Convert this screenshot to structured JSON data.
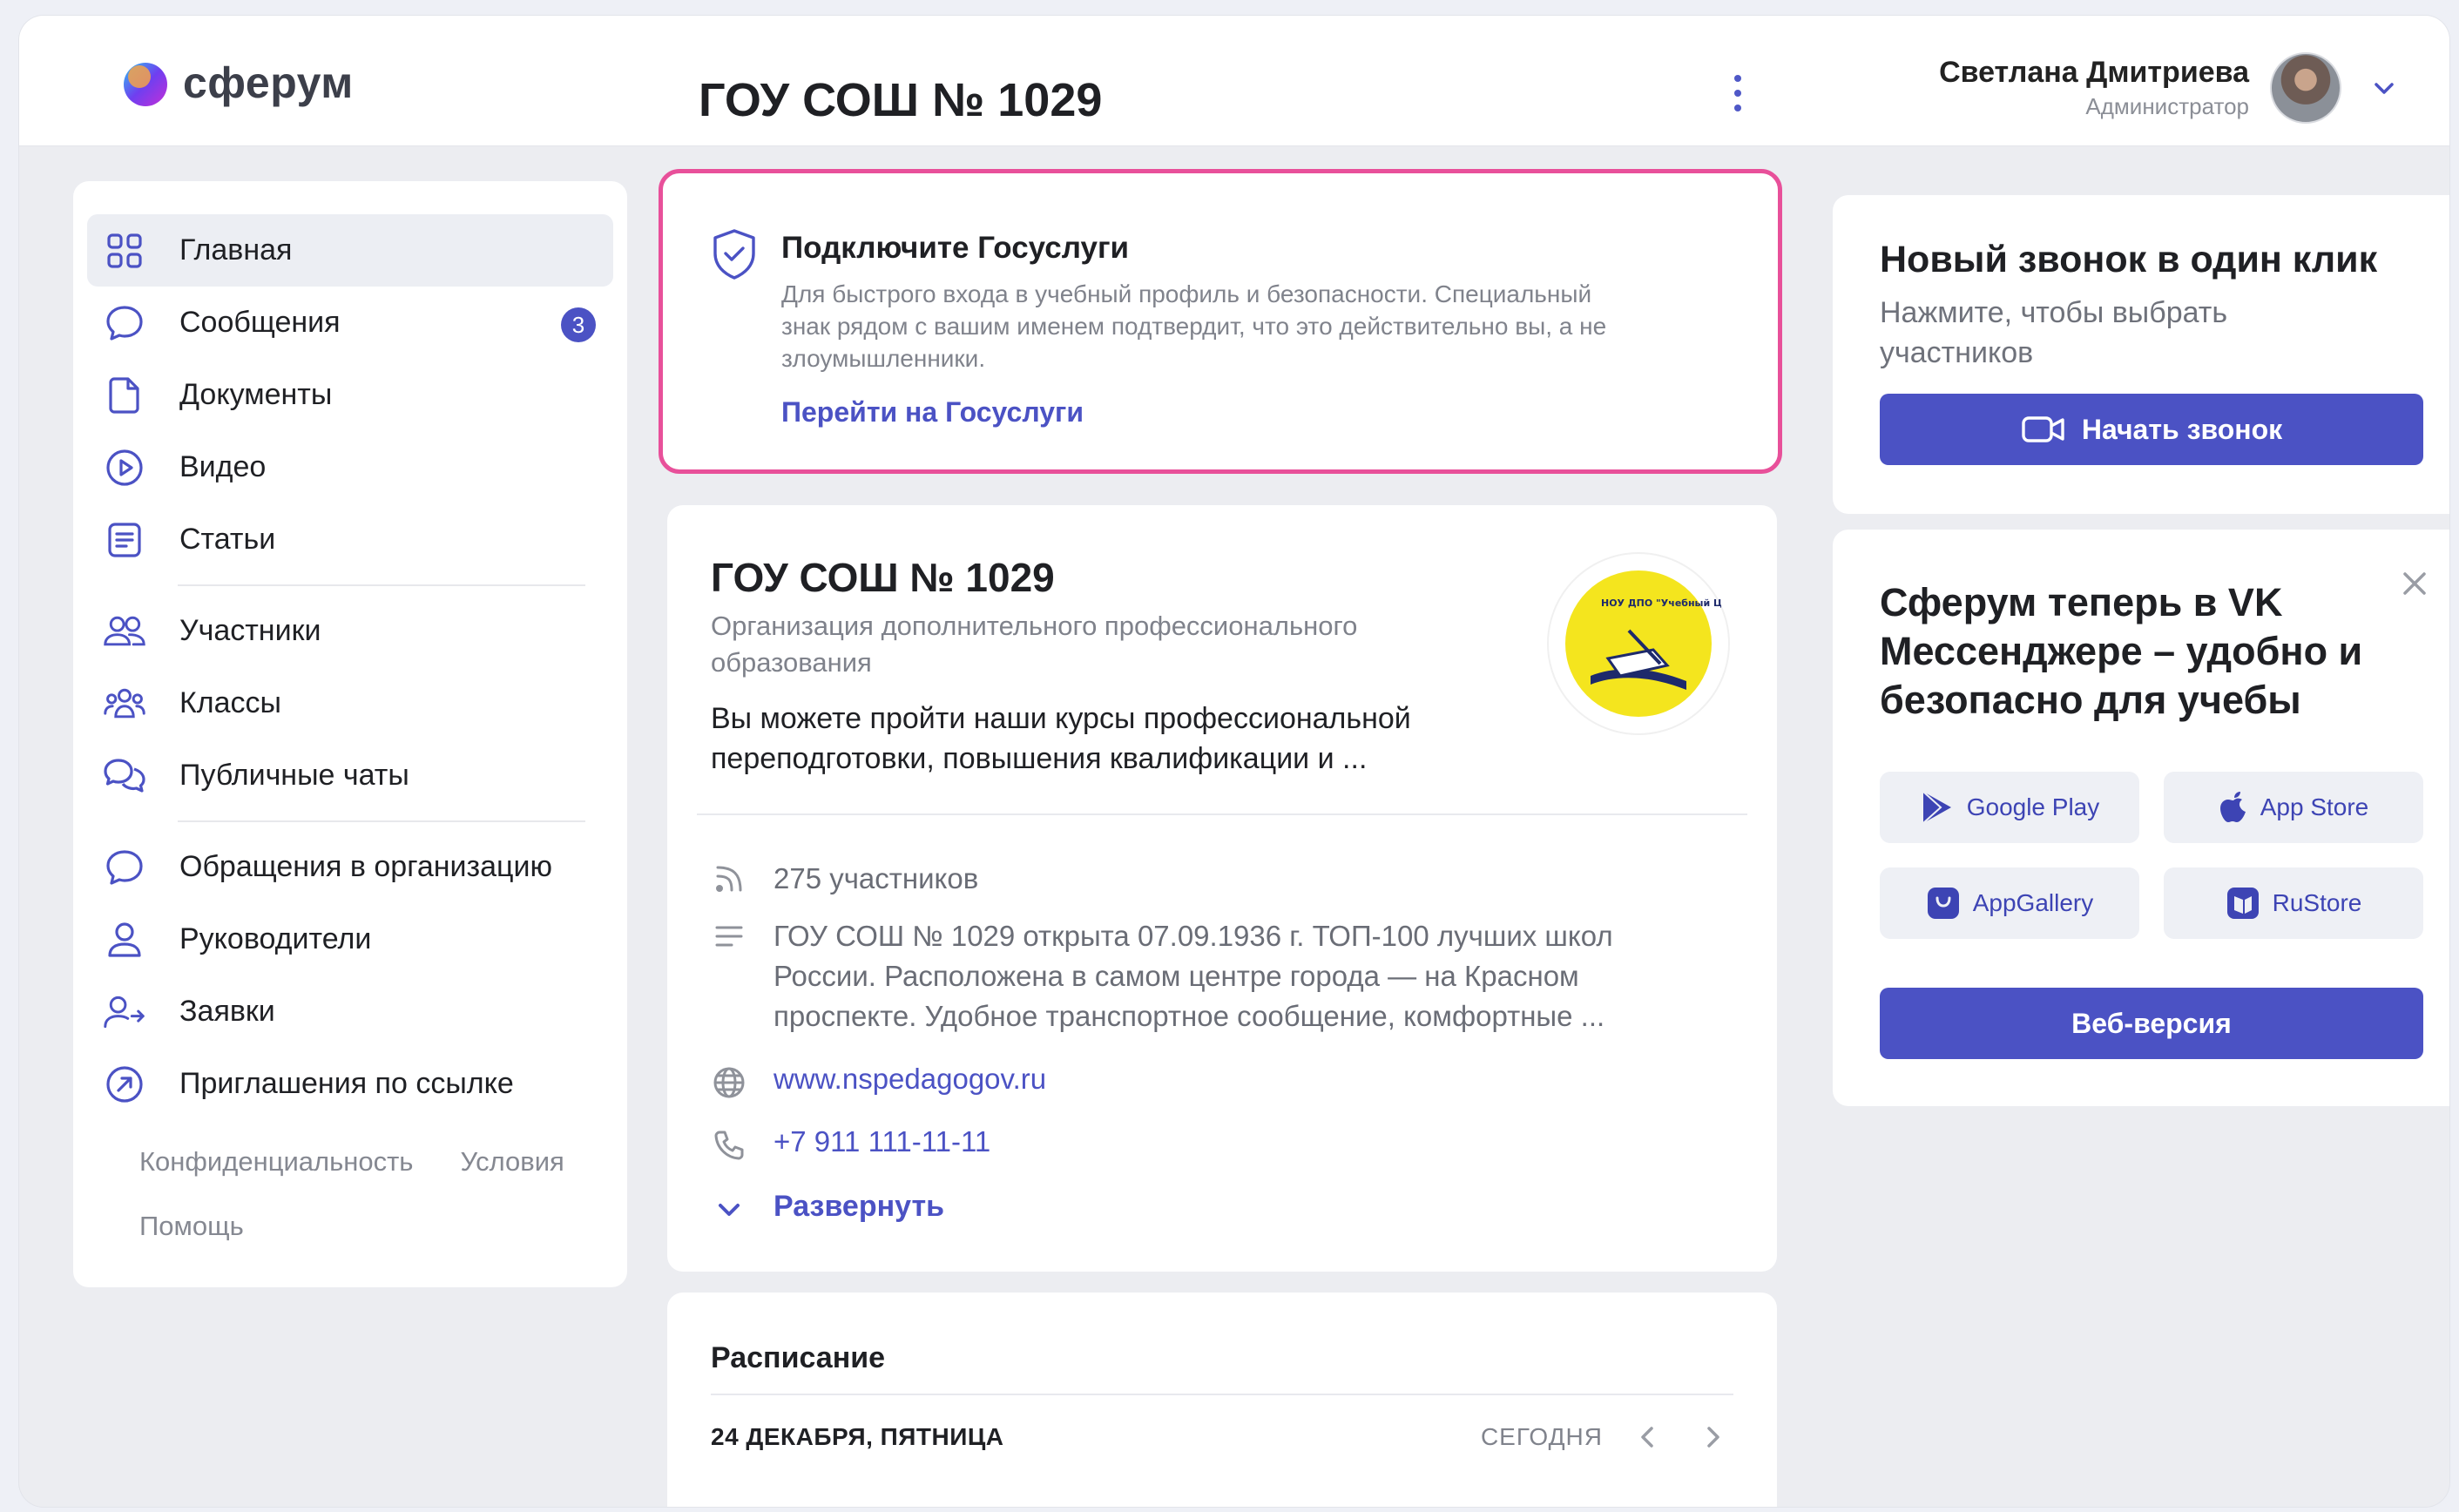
{
  "header": {
    "logo_text": "сферум",
    "org_title": "ГОУ СОШ № 1029",
    "user": {
      "name": "Светлана Дмитриева",
      "role": "Администратор"
    }
  },
  "sidebar": {
    "items": [
      {
        "label": "Главная",
        "icon": "grid-icon",
        "active": true
      },
      {
        "label": "Сообщения",
        "icon": "chat-bubble-icon",
        "badge": "3"
      },
      {
        "label": "Документы",
        "icon": "document-icon"
      },
      {
        "label": "Видео",
        "icon": "play-circle-icon"
      },
      {
        "label": "Статьи",
        "icon": "article-icon"
      },
      {
        "label": "Участники",
        "icon": "people-icon"
      },
      {
        "label": "Классы",
        "icon": "group-icon"
      },
      {
        "label": "Публичные чаты",
        "icon": "chats-icon"
      },
      {
        "label": "Обращения в организацию",
        "icon": "chat-bubble-icon"
      },
      {
        "label": "Руководители",
        "icon": "user-icon"
      },
      {
        "label": "Заявки",
        "icon": "user-arrow-icon"
      },
      {
        "label": "Приглашения по ссылке",
        "icon": "link-arrow-icon"
      }
    ],
    "footer": {
      "privacy": "Конфиденциальность",
      "terms": "Условия",
      "help": "Помощь"
    }
  },
  "gosuslugi": {
    "title": "Подключите Госуслуги",
    "text": "Для быстрого входа в учебный профиль и безопасности. Специальный знак рядом с вашим именем подтвердит, что это действительно вы, а не злоумышленники.",
    "link": "Перейти на Госуслуги"
  },
  "organization": {
    "name": "ГОУ СОШ № 1029",
    "type": "Организация дополнительного профессионального образования",
    "description": "Вы можете пройти наши курсы профессиональной переподготовки, повышения квалификации и ...",
    "logo_text": "НОУ ДПО \"Учебный Центр \"Педагогические Знания\"",
    "members": "275 участников",
    "about": "ГОУ СОШ № 1029 открыта 07.09.1936 г. ТОП-100 лучших школ России. Расположена в самом центре города — на Красном проспекте. Удобное транспортное сообщение, комфортные ...",
    "website": "www.nspedagogov.ru",
    "phone": "+7 911 111-11-11",
    "expand": "Развернуть"
  },
  "schedule": {
    "title": "Расписание",
    "date": "24 ДЕКАБРЯ, ПЯТНИЦА",
    "today": "СЕГОДНЯ"
  },
  "call": {
    "title": "Новый звонок в один клик",
    "subtitle": "Нажмите, чтобы выбрать участников",
    "button": "Начать звонок"
  },
  "vk_promo": {
    "title": "Сферум теперь в VK Мессенджере – удобно и безопасно для учебы",
    "stores": [
      "Google Play",
      "App Store",
      "AppGallery",
      "RuStore"
    ],
    "web_button": "Веб-версия"
  },
  "colors": {
    "accent": "#4b52c4",
    "highlight_border": "#e8509a",
    "background": "#ecedf1"
  }
}
